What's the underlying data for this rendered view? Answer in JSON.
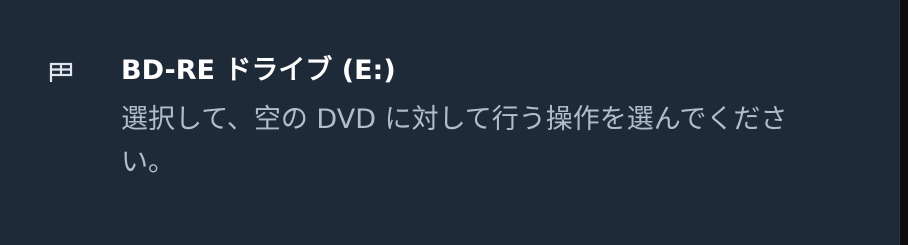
{
  "toast": {
    "icon": "drive-icon",
    "title": "BD-RE ドライブ (E:)",
    "message": "選択して、空の DVD に対して行う操作を選んでください。"
  },
  "colors": {
    "background": "#1f2a38",
    "title": "#ffffff",
    "message": "#b3bdc8"
  }
}
